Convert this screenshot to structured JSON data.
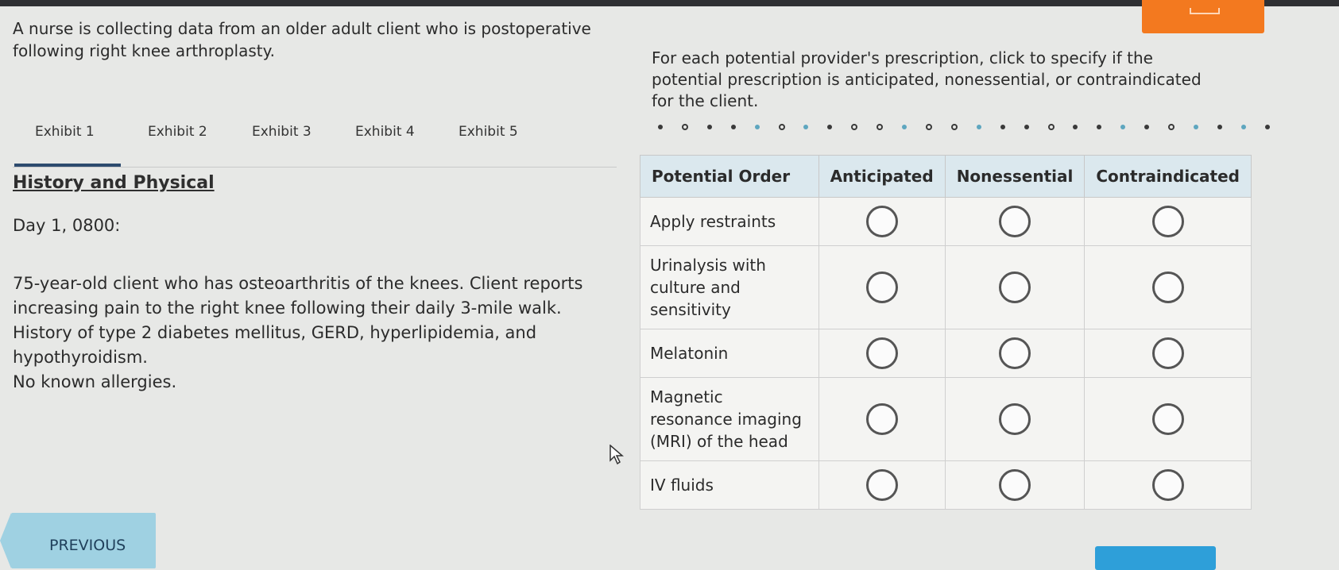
{
  "scenario": "A nurse is collecting data from an older adult client who is postoperative following right knee arthroplasty.",
  "instructions": "For each potential provider's prescription, click to specify if the potential prescription is anticipated, nonessential, or contraindicated for the client.",
  "tabs": [
    {
      "label": "Exhibit 1"
    },
    {
      "label": "Exhibit 2"
    },
    {
      "label": "Exhibit 3"
    },
    {
      "label": "Exhibit 4"
    },
    {
      "label": "Exhibit 5"
    }
  ],
  "exhibit": {
    "title": "History and Physical",
    "day": "Day 1, 0800:",
    "lines": [
      "75-year-old client who has osteoarthritis of the knees. Client reports increasing pain to the right knee following their daily 3-mile walk.",
      "History of type 2 diabetes mellitus, GERD, hyperlipidemia, and hypothyroidism.",
      "No known allergies."
    ]
  },
  "table": {
    "headers": [
      "Potential Order",
      "Anticipated",
      "Nonessential",
      "Contraindicated"
    ],
    "rows": [
      {
        "order": "Apply restraints"
      },
      {
        "order": "Urinalysis with culture and sensitivity"
      },
      {
        "order": "Melatonin"
      },
      {
        "order": "Magnetic resonance imaging (MRI) of the head"
      },
      {
        "order": "IV fluids"
      }
    ]
  },
  "buttons": {
    "previous": "PREVIOUS"
  },
  "colors": {
    "accent_orange": "#f3791f",
    "header_bg": "#dbe8ee",
    "prev_button": "#9fd1e2",
    "tab_underline": "#2d4b6e"
  },
  "icons": {
    "cursor": "mouse-pointer-icon"
  }
}
